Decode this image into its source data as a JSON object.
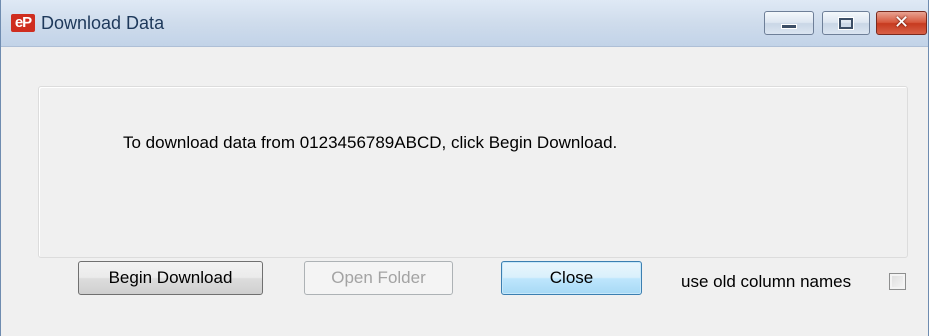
{
  "window": {
    "title": "Download Data",
    "app_icon_text": "eP",
    "controls": {
      "minimize": "minimize-icon",
      "maximize": "maximize-icon",
      "close": "close-icon",
      "close_glyph": "✕"
    }
  },
  "panel": {
    "message": "To download data from 0123456789ABCD, click Begin Download."
  },
  "buttons": {
    "begin_download": "Begin Download",
    "open_folder": "Open Folder",
    "close": "Close"
  },
  "options": {
    "use_old_column_names_label": "use old column names",
    "use_old_column_names_checked": false
  },
  "colors": {
    "title_text": "#1e395b",
    "close_control": "#c63a1f",
    "default_button_border": "#3c7fb1",
    "disabled_text": "#a3a3a3"
  }
}
